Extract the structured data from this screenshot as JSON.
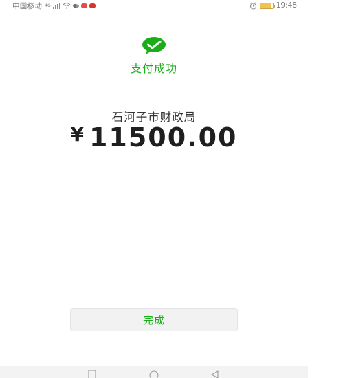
{
  "status_bar": {
    "carrier": "中国移动",
    "signal_label": "4G",
    "time": "19:48",
    "battery_level": 0.85
  },
  "payment": {
    "status_text": "支付成功",
    "payee": "石河子市财政局",
    "currency_symbol": "¥",
    "amount": "11500.00"
  },
  "actions": {
    "done_label": "完成"
  },
  "icons": {
    "success": "wechat-pay-check-icon",
    "alarm": "alarm-icon",
    "nav_recent": "square-recent-icon",
    "nav_home": "circle-home-icon",
    "nav_back": "triangle-back-icon"
  },
  "colors": {
    "accent": "#1aad19",
    "text_primary": "#1f1f1f",
    "button_bg": "#f2f2f2"
  }
}
